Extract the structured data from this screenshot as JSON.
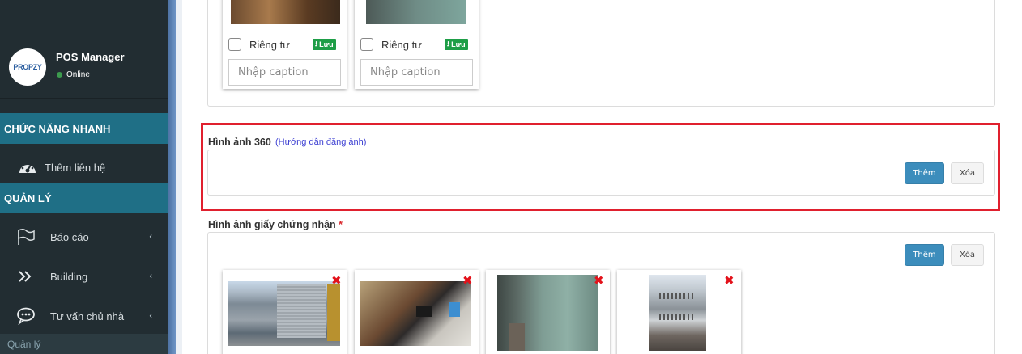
{
  "sidebar": {
    "user_name": "POS Manager",
    "user_status": "Online",
    "avatar_text": "PROPZY",
    "quick_header": "CHỨC NĂNG NHANH",
    "quick_items": [
      {
        "label": "Thêm liên hệ",
        "icon": "dashboard-icon"
      }
    ],
    "manage_header": "QUẢN LÝ",
    "manage_items": [
      {
        "label": "Báo cáo",
        "icon": "flag-icon"
      },
      {
        "label": "Building",
        "icon": "double-chevron-right-icon"
      },
      {
        "label": "Tư vấn chủ nhà",
        "icon": "chat-bubble-icon"
      }
    ],
    "submenu_label": "Quản lý",
    "chevron": "‹"
  },
  "top_photos": [
    {
      "private_label": "Riêng tư",
      "save_label": "Lưu",
      "caption_placeholder": "Nhập caption"
    },
    {
      "private_label": "Riêng tư",
      "save_label": "Lưu",
      "caption_placeholder": "Nhập caption"
    }
  ],
  "section_360": {
    "title": "Hình ảnh 360",
    "guide_link": "(Hướng dẫn đăng ảnh)",
    "add_label": "Thêm",
    "delete_label": "Xóa"
  },
  "section_cert": {
    "title": "Hình ảnh giấy chứng nhận",
    "required_mark": "*",
    "add_label": "Thêm",
    "delete_label": "Xóa",
    "remove_icon": "✖"
  },
  "colors": {
    "sidebar_bg": "#222d32",
    "section_header_bg": "#1f6f86",
    "primary_button": "#3c8dbc",
    "save_badge": "#1e9e47",
    "highlight_border": "#e0202e",
    "remove_icon": "#e3121b"
  }
}
